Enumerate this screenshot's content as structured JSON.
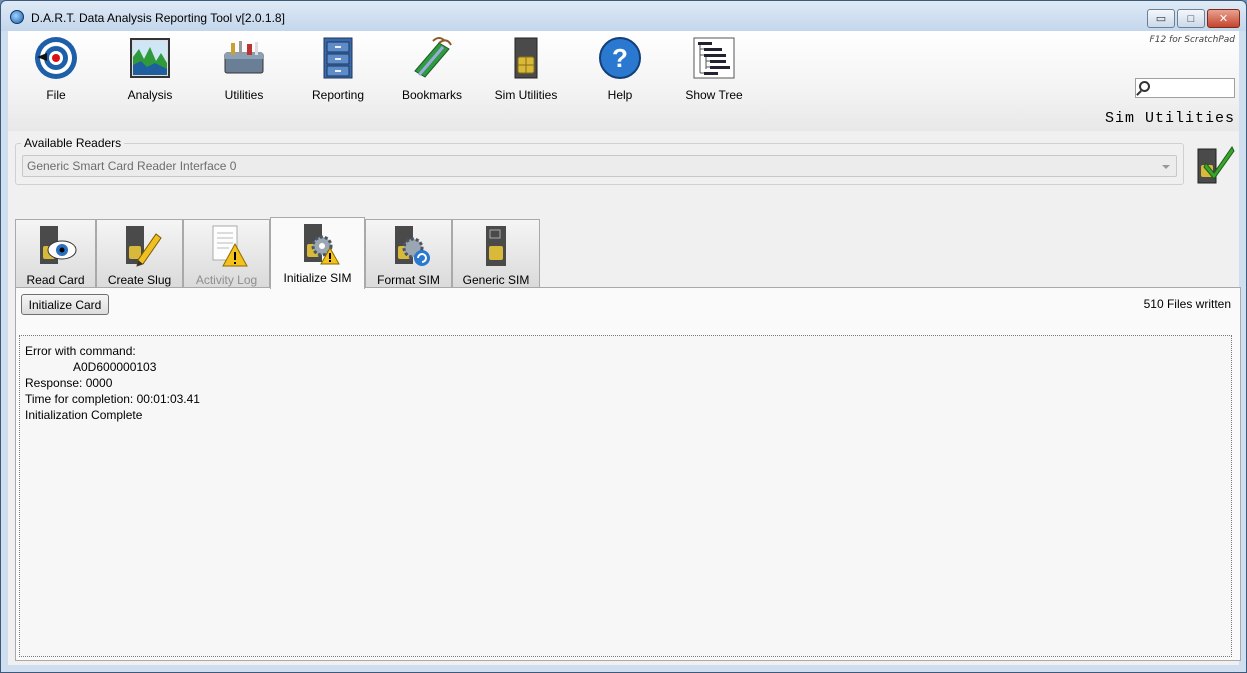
{
  "window": {
    "title": "D.A.R.T. Data Analysis Reporting Tool v[2.0.1.8]",
    "minimize": "▭",
    "maximize": "□",
    "close": "✕"
  },
  "ribbon": {
    "buttons": [
      {
        "label": "File",
        "icon": "file-icon"
      },
      {
        "label": "Analysis",
        "icon": "analysis-chart-icon"
      },
      {
        "label": "Utilities",
        "icon": "toolbox-icon"
      },
      {
        "label": "Reporting",
        "icon": "file-cabinet-icon"
      },
      {
        "label": "Bookmarks",
        "icon": "bookmarks-icon"
      },
      {
        "label": "Sim Utilities",
        "icon": "sim-card-icon"
      },
      {
        "label": "Help",
        "icon": "help-icon"
      },
      {
        "label": "Show Tree",
        "icon": "tree-icon"
      }
    ],
    "f12_hint": "F12 for ScratchPad",
    "search_placeholder": ""
  },
  "section_title": "Sim Utilities",
  "readers": {
    "legend": "Available Readers",
    "selected": "Generic Smart Card Reader Interface 0"
  },
  "tabs": [
    {
      "label": "Read Card",
      "icon": "sim-eye-icon",
      "state": "normal"
    },
    {
      "label": "Create Slug",
      "icon": "sim-pencil-icon",
      "state": "normal"
    },
    {
      "label": "Activity Log",
      "icon": "log-warning-icon",
      "state": "disabled"
    },
    {
      "label": "Initialize SIM",
      "icon": "sim-gear-warning-icon",
      "state": "active"
    },
    {
      "label": "Format SIM",
      "icon": "sim-gear-refresh-icon",
      "state": "normal"
    },
    {
      "label": "Generic SIM",
      "icon": "sim-card-icon",
      "state": "normal"
    }
  ],
  "panel": {
    "initialize_button": "Initialize Card",
    "files_written": "510 Files written",
    "log": {
      "line1": "Error with command:",
      "line2": "A0D600000103",
      "line3": "Response: 0000",
      "line4": "Time for completion: 00:01:03.41",
      "line5": "Initialization Complete"
    }
  },
  "colors": {
    "window_frame": "#cfdff0",
    "client_bg": "#f0f0f0",
    "close_button": "#c5452d"
  }
}
